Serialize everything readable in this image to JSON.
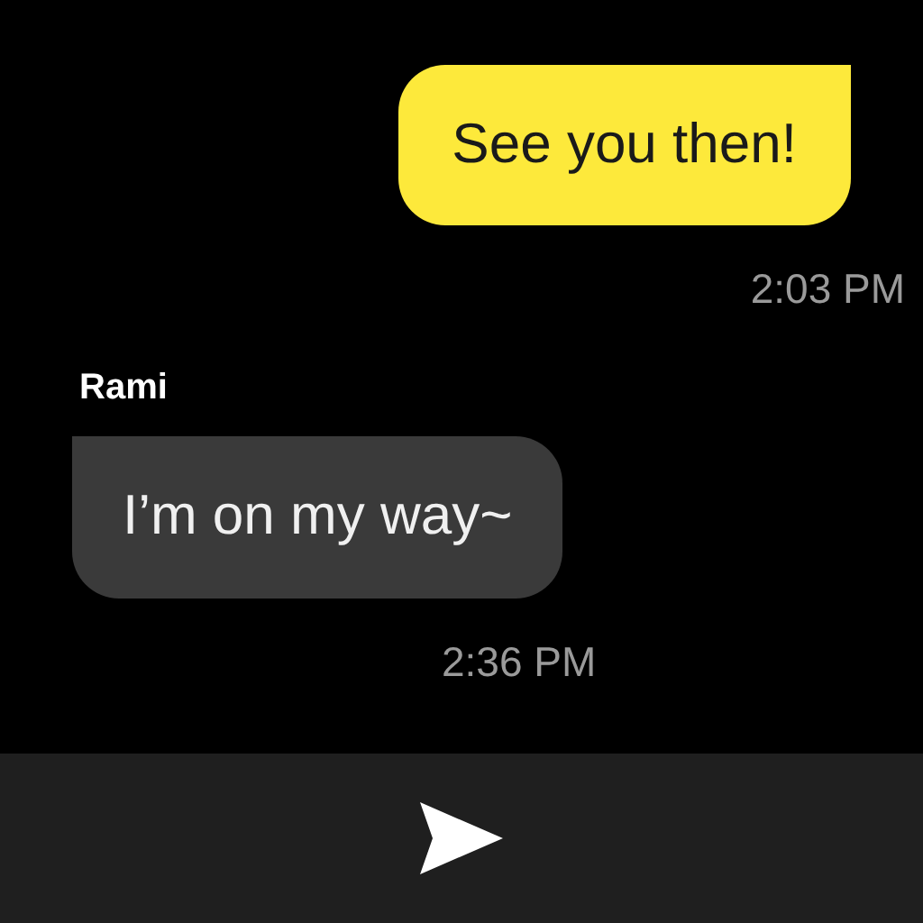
{
  "messages": [
    {
      "kind": "outgoing",
      "text": "See you then!",
      "time": "2:03 PM"
    },
    {
      "kind": "incoming",
      "sender": "Rami",
      "text": "I’m on my way~",
      "time": "2:36 PM"
    }
  ]
}
